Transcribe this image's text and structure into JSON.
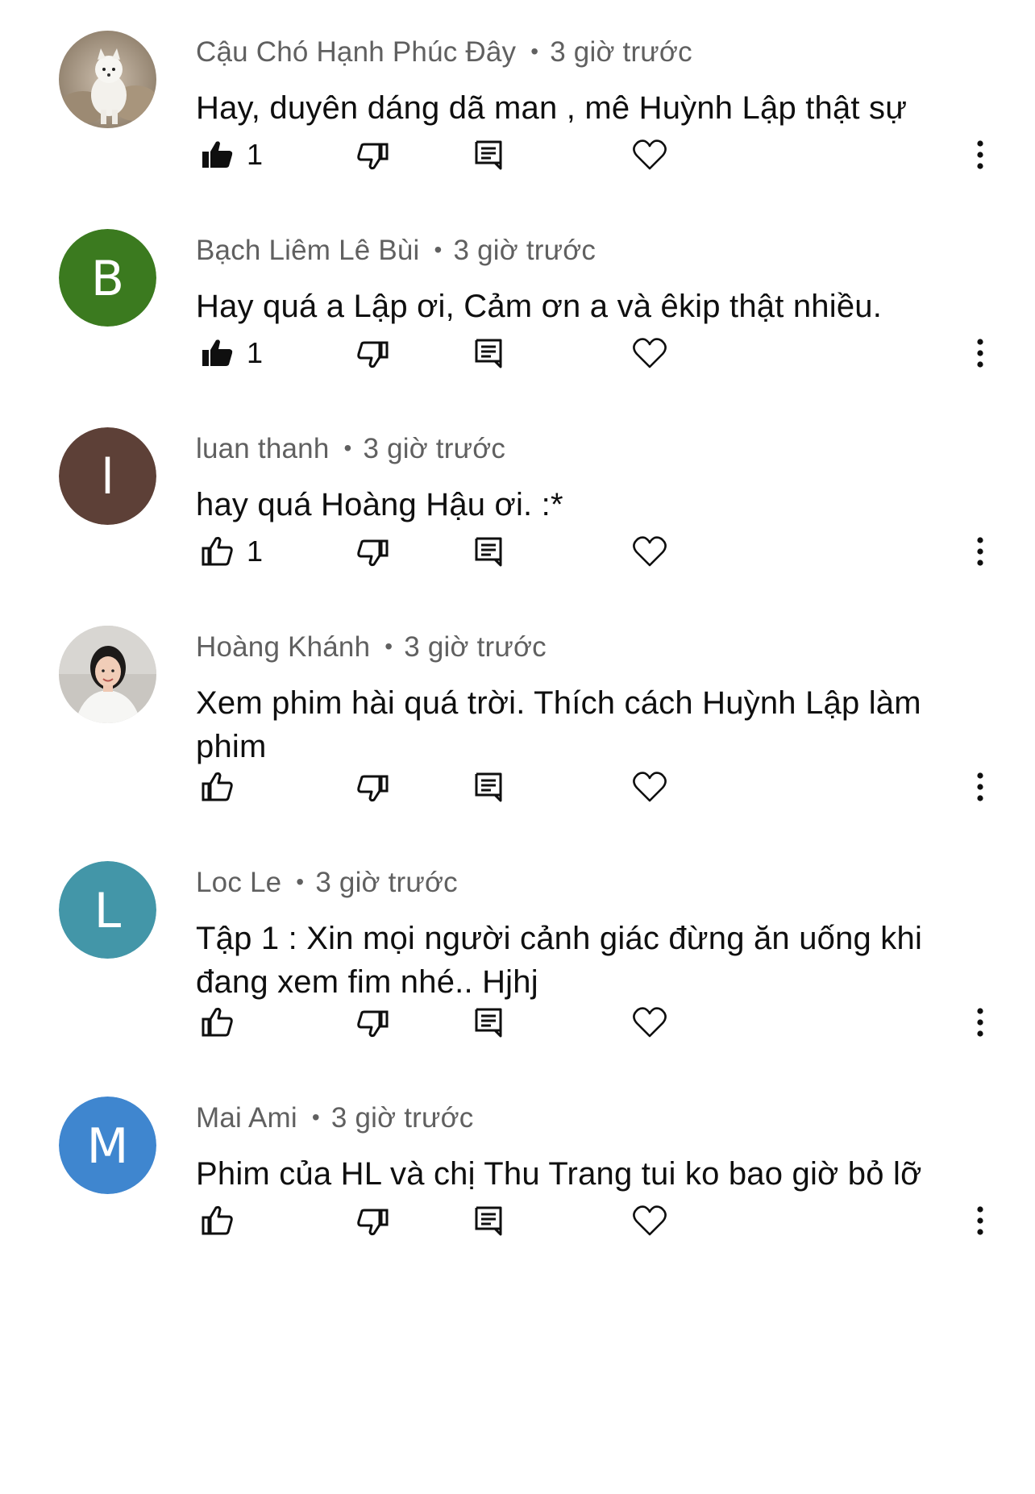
{
  "comments": [
    {
      "author": "Cậu Chó Hạnh Phúc Đây",
      "time": "3 giờ trước",
      "text": "Hay, duyên dáng dã man , mê Huỳnh Lập thật sự",
      "likes": "1",
      "liked": true,
      "avatar": {
        "type": "photo",
        "icon": "dog-photo-avatar"
      }
    },
    {
      "author": "Bạch Liêm Lê Bùi",
      "time": "3 giờ trước",
      "text": "Hay quá a Lập ơi, Cảm ơn a và êkip thật nhiều.",
      "likes": "1",
      "liked": true,
      "avatar": {
        "type": "letter",
        "letter": "B",
        "color": "#3b7a1f"
      }
    },
    {
      "author": "luan thanh",
      "time": "3 giờ trước",
      "text": "hay quá Hoàng Hậu ơi. :*",
      "likes": "1",
      "liked": false,
      "avatar": {
        "type": "letter",
        "letter": "l",
        "color": "#5d4037"
      }
    },
    {
      "author": "Hoàng Khánh",
      "time": "3 giờ trước",
      "text": "Xem phim hài quá trời. Thích cách Huỳnh Lập làm phim",
      "likes": "",
      "liked": false,
      "avatar": {
        "type": "photo",
        "icon": "person-photo-avatar"
      }
    },
    {
      "author": "Loc Le",
      "time": "3 giờ trước",
      "text": "Tập 1 :  Xin mọi người cảnh giác đừng ăn uống khi đang xem fim nhé.. Hjhj",
      "likes": "",
      "liked": false,
      "avatar": {
        "type": "letter",
        "letter": "L",
        "color": "#4396a8"
      }
    },
    {
      "author": "Mai Ami",
      "time": "3 giờ trước",
      "text": "Phim của HL và chị Thu Trang tui ko bao giờ bỏ lỡ",
      "likes": "",
      "liked": false,
      "avatar": {
        "type": "letter",
        "letter": "M",
        "color": "#3f86cf"
      }
    }
  ],
  "meta_separator": "•",
  "colors": {
    "text": "#0f0f0f",
    "meta": "#606060",
    "background": "#ffffff"
  },
  "icons": [
    "thumbs-up-icon",
    "thumbs-down-icon",
    "reply-icon",
    "heart-icon",
    "more-vert-icon"
  ]
}
